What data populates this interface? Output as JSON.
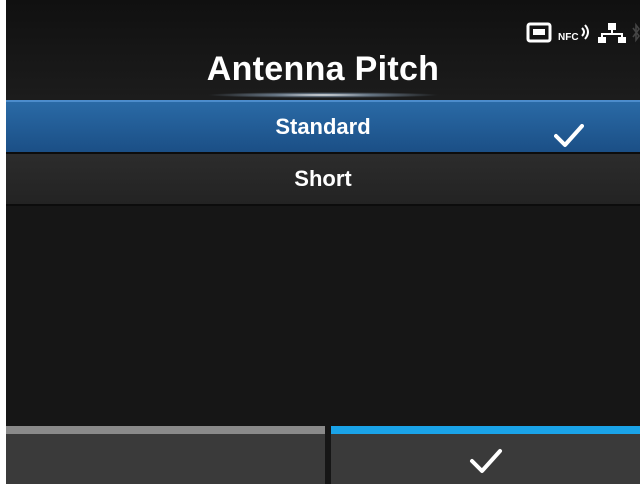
{
  "header": {
    "title": "Antenna Pitch",
    "status_icons": [
      "sd-card-icon",
      "nfc-icon",
      "network-icon",
      "bluetooth-icon"
    ],
    "nfc_label": "NFC"
  },
  "list": {
    "items": [
      {
        "label": "Standard",
        "selected": true
      },
      {
        "label": "Short",
        "selected": false
      }
    ]
  },
  "softkeys": {
    "left": {
      "label": ""
    },
    "right": {
      "icon": "check-icon"
    }
  },
  "colors": {
    "selected_bg": "#1b4f86",
    "accent_bar": "#1aa3e8",
    "inactive_bar": "#8a8a8a",
    "background": "#161616"
  }
}
